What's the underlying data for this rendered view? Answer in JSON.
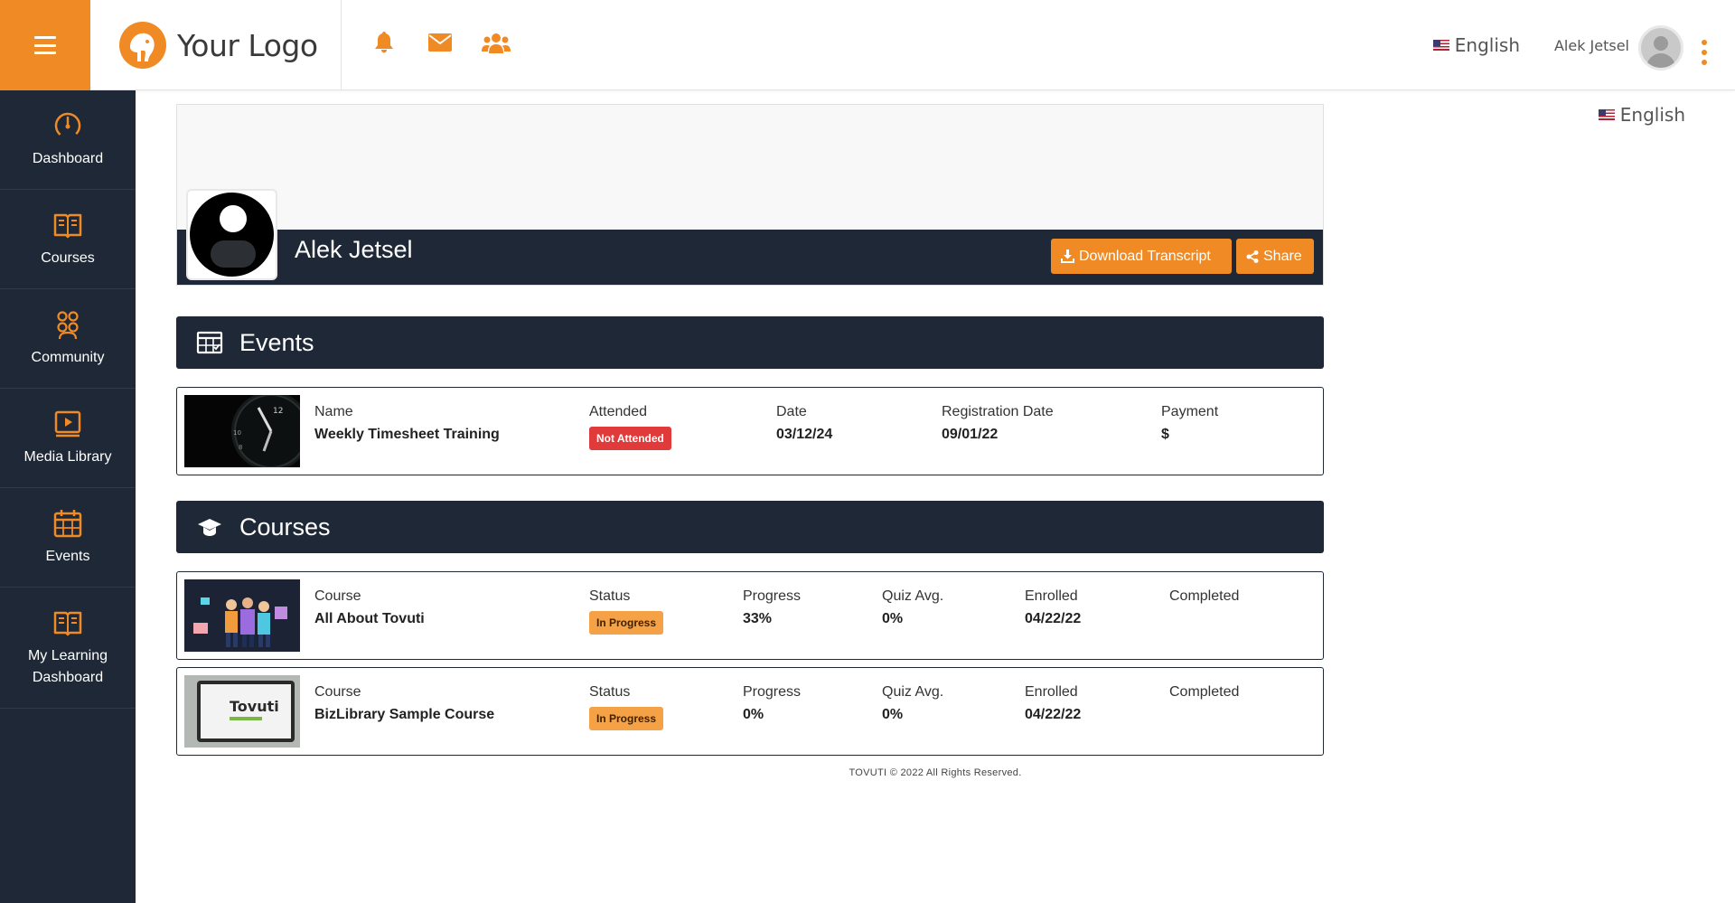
{
  "app": {
    "logo_text": "Your Logo",
    "language": "English",
    "user_name": "Alek Jetsel",
    "accent": "#F08A24",
    "dark": "#1E2836"
  },
  "top_icons": [
    "bell-icon",
    "envelope-icon",
    "users-icon"
  ],
  "sidebar": {
    "items": [
      {
        "label": "Dashboard",
        "icon": "dashboard-gauge-icon"
      },
      {
        "label": "Courses",
        "icon": "open-book-icon"
      },
      {
        "label": "Community",
        "icon": "community-people-icon"
      },
      {
        "label": "Media Library",
        "icon": "media-play-icon"
      },
      {
        "label": "Events",
        "icon": "calendar-icon"
      },
      {
        "label": "My Learning Dashboard",
        "icon": "open-book-icon"
      }
    ]
  },
  "profile": {
    "name": "Alek Jetsel",
    "download_label": "Download Transcript",
    "share_label": "Share"
  },
  "events": {
    "title": "Events",
    "rows": [
      {
        "name_label": "Name",
        "name": "Weekly Timesheet Training",
        "attended_label": "Attended",
        "attended": "Not Attended",
        "date_label": "Date",
        "date": "03/12/24",
        "reg_label": "Registration Date",
        "reg_date": "09/01/22",
        "payment_label": "Payment",
        "payment": "$"
      }
    ]
  },
  "courses": {
    "title": "Courses",
    "rows": [
      {
        "course_label": "Course",
        "course": "All About Tovuti",
        "status_label": "Status",
        "status": "In Progress",
        "progress_label": "Progress",
        "progress": "33%",
        "quiz_label": "Quiz Avg.",
        "quiz": "0%",
        "enrolled_label": "Enrolled",
        "enrolled": "04/22/22",
        "completed_label": "Completed",
        "completed": ""
      },
      {
        "course_label": "Course",
        "course": "BizLibrary Sample Course",
        "status_label": "Status",
        "status": "In Progress",
        "progress_label": "Progress",
        "progress": "0%",
        "quiz_label": "Quiz Avg.",
        "quiz": "0%",
        "enrolled_label": "Enrolled",
        "enrolled": "04/22/22",
        "completed_label": "Completed",
        "completed": "",
        "thumb_text": "Tovuti"
      }
    ]
  },
  "footer": "TOVUTI © 2022 All Rights Reserved."
}
